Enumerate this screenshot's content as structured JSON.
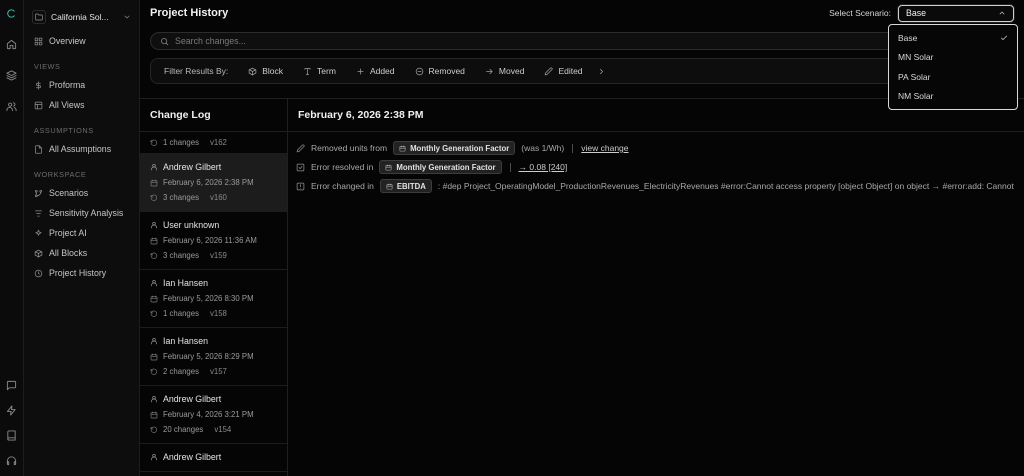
{
  "theme": {
    "accent": "#2fd4c2",
    "selected_row_bg": "#1c1c1c",
    "focus_border": "#cfcfcf"
  },
  "icons": [
    "logo",
    "home",
    "layers",
    "users",
    "message",
    "zap",
    "book",
    "headset",
    "folder",
    "chevron-down",
    "chevron-up",
    "chevron-right",
    "grid",
    "dollar",
    "table",
    "file",
    "branch",
    "funnel",
    "sparkle",
    "cube",
    "clock",
    "search",
    "calendar",
    "user",
    "history",
    "pencil",
    "check-square",
    "alert-square",
    "plus",
    "minus-circle",
    "arrow-right",
    "check",
    "type"
  ],
  "sidebar": {
    "project_label": "California Sol...",
    "overview_label": "Overview",
    "views_label": "VIEWS",
    "views_items": [
      "Proforma",
      "All Views"
    ],
    "assumptions_label": "ASSUMPTIONS",
    "assumptions_items": [
      "All Assumptions"
    ],
    "workspace_label": "WORKSPACE",
    "workspace_items": [
      "Scenarios",
      "Sensitivity Analysis",
      "Project AI",
      "All Blocks",
      "Project History"
    ]
  },
  "header": {
    "title": "Project History"
  },
  "scenario": {
    "label": "Select Scenario:",
    "value": "Base",
    "options": [
      "Base",
      "MN Solar",
      "PA Solar",
      "NM Solar"
    ],
    "selected_index": 0
  },
  "search": {
    "placeholder": "Search changes..."
  },
  "filters": {
    "label": "Filter Results By:",
    "items": [
      "Block",
      "Term",
      "Added",
      "Removed",
      "Moved",
      "Edited"
    ]
  },
  "changelog": {
    "title": "Change Log",
    "top_partial": {
      "changes": "1 changes",
      "version": "v162"
    },
    "entries": [
      {
        "author": "Andrew Gilbert",
        "date": "February 6, 2026 2:38 PM",
        "changes": "3 changes",
        "version": "v160"
      },
      {
        "author": "User unknown",
        "date": "February 6, 2026 11:36 AM",
        "changes": "3 changes",
        "version": "v159"
      },
      {
        "author": "Ian Hansen",
        "date": "February 5, 2026 8:30 PM",
        "changes": "1 changes",
        "version": "v158"
      },
      {
        "author": "Ian Hansen",
        "date": "February 5, 2026 8:29 PM",
        "changes": "2 changes",
        "version": "v157"
      },
      {
        "author": "Andrew Gilbert",
        "date": "February 4, 2026 3:21 PM",
        "changes": "20 changes",
        "version": "v154"
      }
    ],
    "bottom_partial": {
      "author": "Andrew Gilbert"
    }
  },
  "detail": {
    "title": "February 6, 2026 2:38 PM",
    "rows": [
      {
        "action": "Removed units from",
        "chip": "Monthly Generation Factor",
        "note": "(was 1/Wh)",
        "link": "view change"
      },
      {
        "action": "Error resolved in",
        "chip": "Monthly Generation Factor",
        "link": "→ 0.08 [240]"
      },
      {
        "action": "Error changed in",
        "chip": "EBITDA",
        "note": ": #dep Project_OperatingModel_ProductionRevenues_ElectricityRevenues #error:Cannot access property [object Object] on object → #error:add: Cannot convert unit \"USD\" to \"USD/M"
      }
    ]
  }
}
